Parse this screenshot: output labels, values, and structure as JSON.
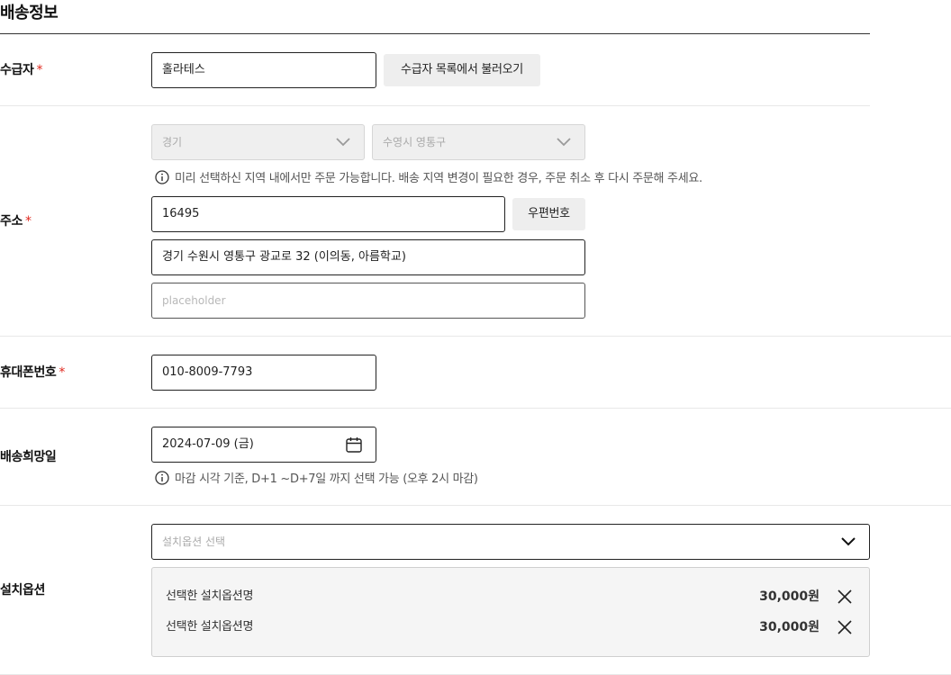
{
  "section": {
    "title": "배송정보"
  },
  "recipient": {
    "label": "수급자",
    "required_mark": "*",
    "value": "홀라테스",
    "load_button": "수급자 목록에서 불러오기"
  },
  "address": {
    "label": "주소",
    "required_mark": "*",
    "region_select": "경기",
    "district_select": "수영시 영통구",
    "notice": "미리 선택하신 지역 내에서만 주문 가능합니다. 배송 지역 변경이 필요한 경우, 주문 취소 후  다시 주문해 주세요.",
    "zipcode": "16495",
    "zip_button": "우편번호",
    "address_line1": "경기 수원시 영통구 광교로 32 (이의동, 아름학교)",
    "address_line2_placeholder": "placeholder"
  },
  "phone": {
    "label": "휴대폰번호",
    "required_mark": "*",
    "value": "010-8009-7793"
  },
  "delivery_date": {
    "label": "배송희망일",
    "value": "2024-07-09 (금)",
    "notice": "마감 시각 기준, D+1 ~D+7일 까지 선택 가능 (오후 2시 마감)"
  },
  "install_option": {
    "label": "설치옵션",
    "select_placeholder": "설치옵션 선택",
    "selected": [
      {
        "name": "선택한 설치옵션명",
        "price": "30,000원"
      },
      {
        "name": "선택한 설치옵션명",
        "price": "30,000원"
      }
    ]
  },
  "colors": {
    "required": "#e0281e",
    "border": "#222222",
    "disabled_bg": "#efefef"
  }
}
